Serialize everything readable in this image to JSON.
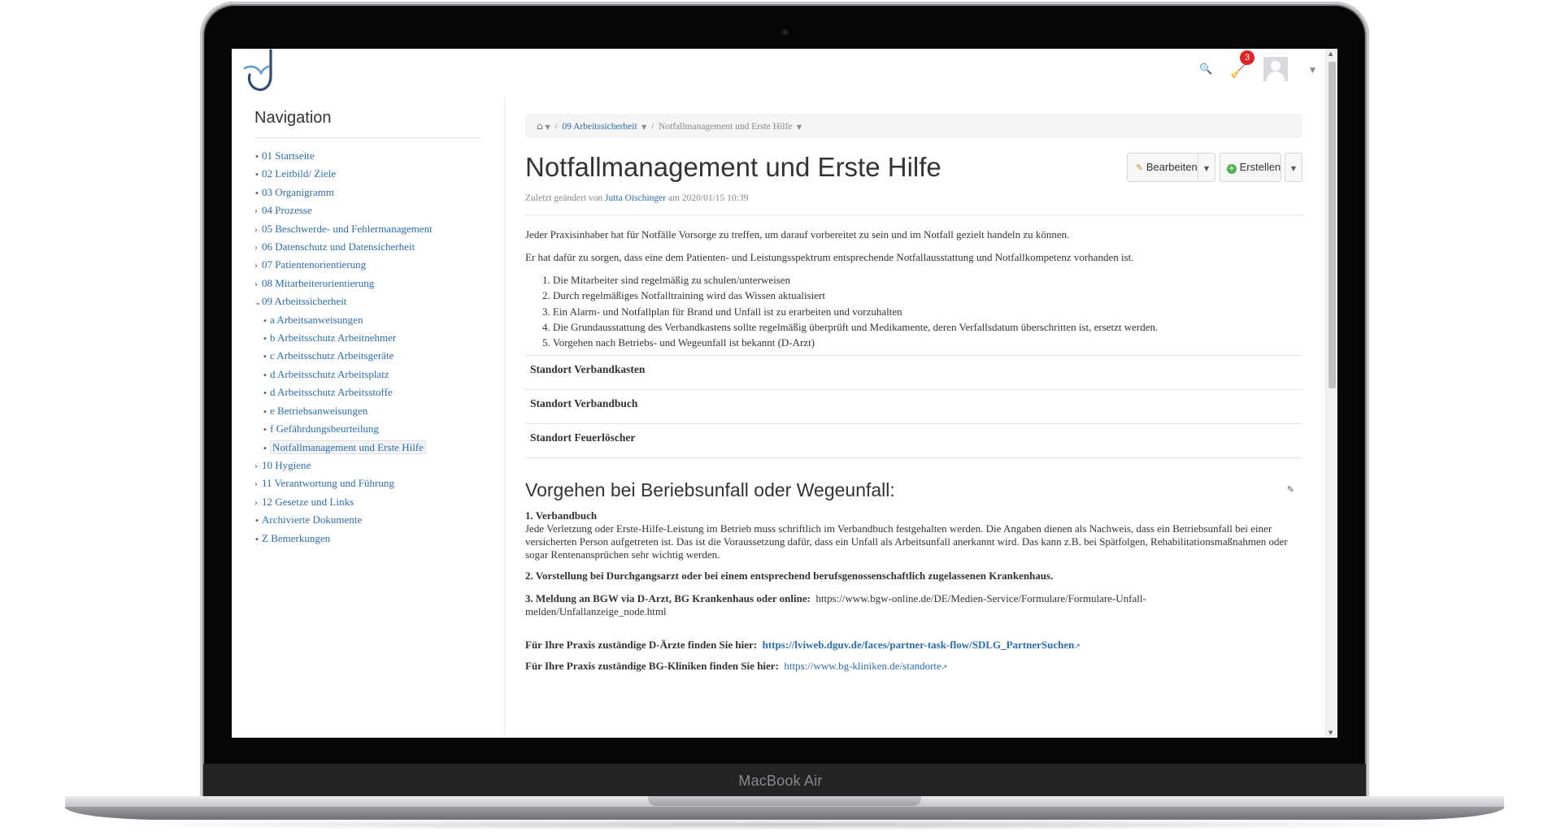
{
  "device": {
    "model_label": "MacBook Air"
  },
  "topbar": {
    "notification_count": "3"
  },
  "sidebar": {
    "title": "Navigation",
    "items": [
      {
        "label": "01 Startseite",
        "marker": "•"
      },
      {
        "label": "02 Leitbild/ Ziele",
        "marker": "•"
      },
      {
        "label": "03 Organigramm",
        "marker": "•"
      },
      {
        "label": "04 Prozesse",
        "marker": "›"
      },
      {
        "label": "05 Beschwerde- und Fehlermanagement",
        "marker": "›"
      },
      {
        "label": "06 Datenschutz und Datensicherheit",
        "marker": "›"
      },
      {
        "label": "07 Patientenorientierung",
        "marker": "›"
      },
      {
        "label": "08 Mitarbeiterorientierung",
        "marker": "›"
      },
      {
        "label": "09 Arbeitssicherheit",
        "marker": "⌄"
      }
    ],
    "subitems": [
      {
        "label": "a Arbeitsanweisungen"
      },
      {
        "label": "b Arbeitsschutz Arbeitnehmer"
      },
      {
        "label": "c Arbeitsschutz Arbeitsgeräte"
      },
      {
        "label": "d Arbeitsschutz Arbeitsplatz"
      },
      {
        "label": "d Arbeitsschutz Arbeitsstoffe"
      },
      {
        "label": "e Betriebsanweisungen"
      },
      {
        "label": "f Gefährdungsbeurteilung"
      },
      {
        "label": "Notfallmanagement und Erste Hilfe"
      }
    ],
    "items_after": [
      {
        "label": "10 Hygiene",
        "marker": "›"
      },
      {
        "label": "11 Verantwortung und Führung",
        "marker": "›"
      },
      {
        "label": "12 Gesetze und Links",
        "marker": "›"
      },
      {
        "label": "Archivierte Dokumente",
        "marker": "•"
      },
      {
        "label": "Z Bemerkungen",
        "marker": "•"
      }
    ]
  },
  "breadcrumb": {
    "level1": "09 Arbeitssicherheit",
    "level2": "Notfallmanagement und Erste Hilfe"
  },
  "page": {
    "title": "Notfallmanagement und Erste Hilfe",
    "meta_prefix": "Zuletzt geändert von",
    "meta_user": "Jutta Oischinger",
    "meta_suffix": "am 2020/01/15 10:39"
  },
  "toolbar": {
    "edit_label": "Bearbeiten",
    "create_label": "Erstellen"
  },
  "body": {
    "intro1": "Jeder Praxisinhaber hat für Notfälle Vorsorge zu treffen, um darauf vorbereitet zu sein  und im Notfall gezielt handeln zu können.",
    "intro2": "Er hat dafür zu sorgen, dass eine dem Patienten- und Leistungsspektrum entsprechende Notfallausstattung und Notfallkompetenz vorhanden ist.",
    "steps": [
      "Die Mitarbeiter sind regelmäßig zu schulen/unterweisen",
      "Durch regelmäßiges Notfalltraining wird das Wissen aktualisiert",
      "Ein Alarm- und Notfallplan für Brand und Unfall ist zu erarbeiten und vorzuhalten",
      "Die Grundausstattung des Verbandkastens sollte regelmäßig überprüft und Medikamente, deren Verfallsdatum überschritten ist, ersetzt werden.",
      "Vorgehen nach Betriebs- und Wegeunfall ist bekannt (D-Arzt)"
    ],
    "locations": [
      "Standort Verbandkasten",
      "Standort Verbandbuch",
      "Standort Feuerlöscher"
    ],
    "section_title": "Vorgehen bei Beriebsunfall oder Wegeunfall:",
    "s1_title": "1. Verbandbuch",
    "s1_text": "Jede Verletzung oder Erste-Hilfe-Leistung im Betrieb muss schriftlich im Verbandbuch festgehalten werden. Die Angaben dienen als Nachweis, dass ein Betriebsunfall bei einer versicherten Person aufgetreten ist. Das ist die Voraussetzung dafür, dass ein Unfall als Arbeitsunfall anerkannt wird. Das kann z.B. bei Spätfolgen, Rehabilitationsmaßnahmen oder sogar Rentenansprüchen sehr wichtig werden.",
    "s2_title": "2. Vorstellung bei Durchgangsarzt oder bei einem entsprechend berufsgenossenschaftlich zugelassenen Krankenhaus.",
    "s3_title": "3. Meldung an BGW via D-Arzt, BG Krankenhaus oder online:",
    "s3_url": "https://www.bgw-online.de/DE/Medien-Service/Formulare/Formulare-Unfall-melden/Unfallanzeige_node.html",
    "darzt_label": "Für Ihre Praxis zuständige D-Ärzte finden Sie hier:",
    "darzt_url": "https://lviweb.dguv.de/faces/partner-task-flow/SDLG_PartnerSuchen",
    "bgk_label": "Für Ihre Praxis zuständige BG-Kliniken finden Sie hier:",
    "bgk_url": "https://www.bg-kliniken.de/standorte"
  },
  "colors": {
    "link": "#2b6cb0",
    "badge": "#e02424",
    "logo": "#2e4a7a"
  }
}
